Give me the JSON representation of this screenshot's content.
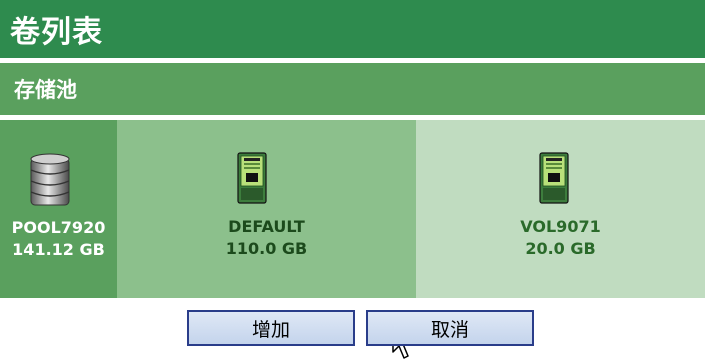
{
  "window": {
    "title": "卷列表"
  },
  "section": {
    "header": "存储池"
  },
  "pool": {
    "name": "POOL7920",
    "size": "141.12 GB",
    "icon": "database-icon"
  },
  "volumes": [
    {
      "name": "DEFAULT",
      "size": "110.0 GB",
      "icon": "server-icon"
    },
    {
      "name": "VOL9071",
      "size": "20.0 GB",
      "icon": "server-icon"
    }
  ],
  "buttons": {
    "add_label": "增加",
    "cancel_label": "取消"
  },
  "colors": {
    "title_bar": "#2e8b4e",
    "section_bar": "#5aa05e",
    "selected_volume": "#8cc08c",
    "volume_bg": "#c0dcc0",
    "button_border": "#2a3d8a"
  }
}
